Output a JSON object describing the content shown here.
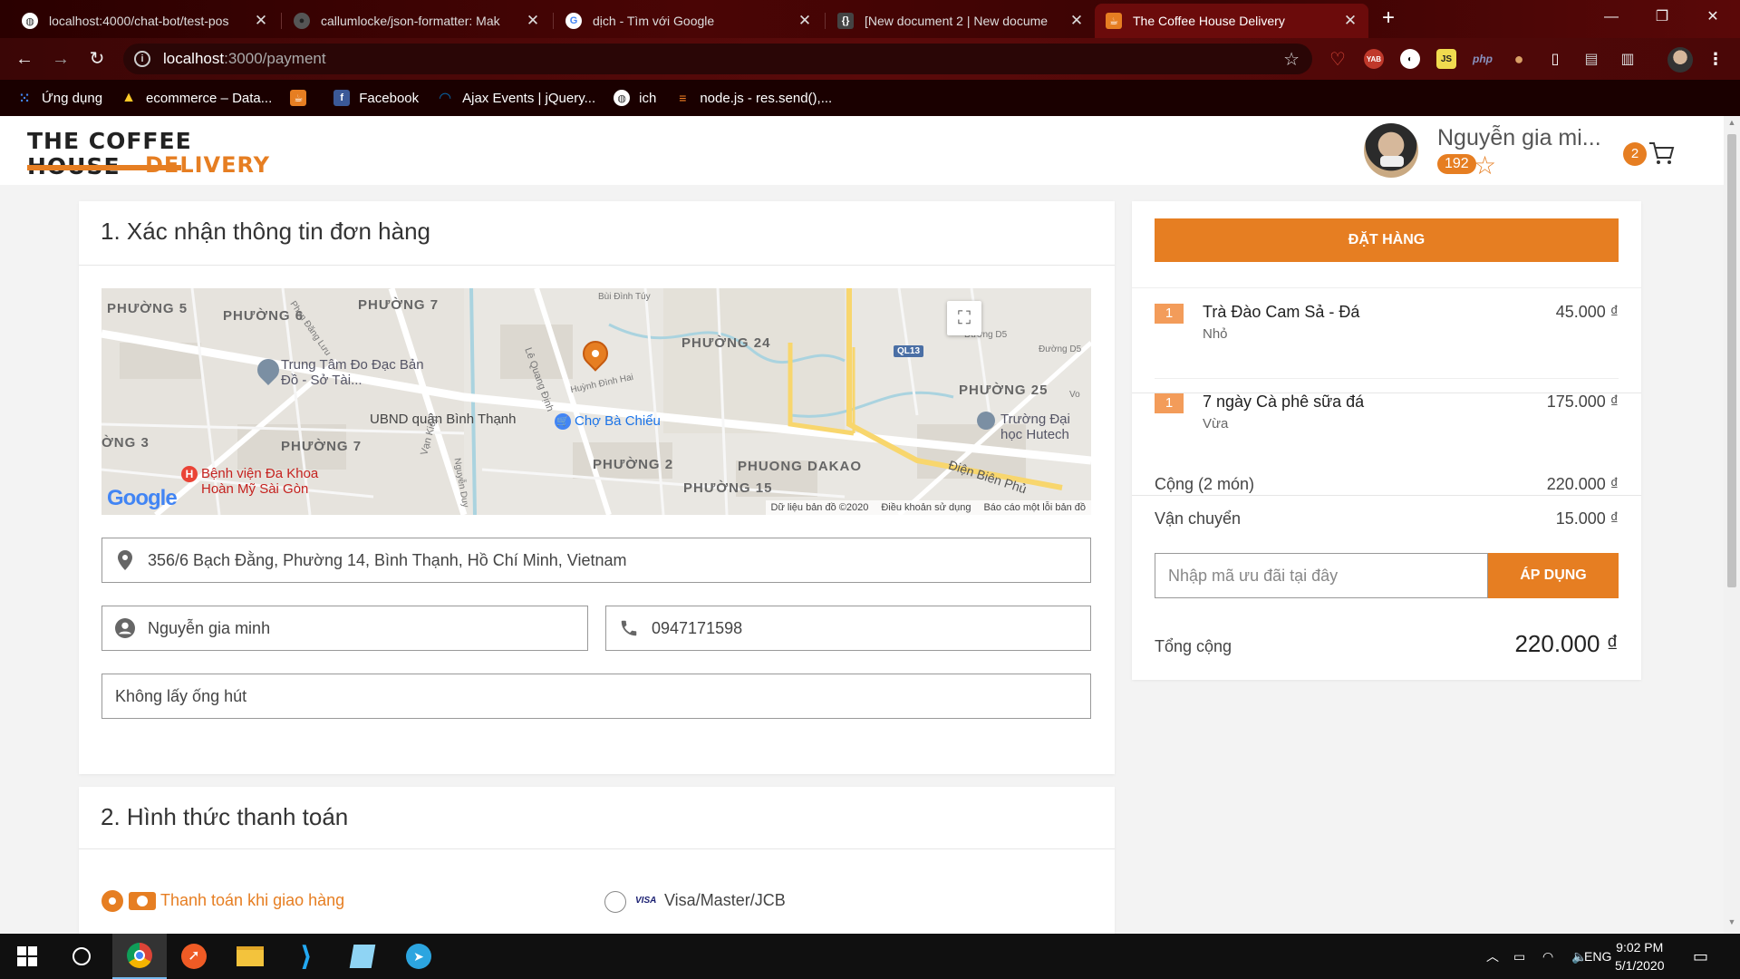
{
  "browser": {
    "tabs": [
      {
        "title": "localhost:4000/chat-bot/test-pos",
        "icon": "globe-icon"
      },
      {
        "title": "callumlocke/json-formatter: Mak",
        "icon": "github-icon"
      },
      {
        "title": "dịch - Tìm với Google",
        "icon": "google-icon"
      },
      {
        "title": "[New document 2 | New docume",
        "icon": "json-icon"
      },
      {
        "title": "The Coffee House Delivery",
        "icon": "coffee-house-icon",
        "active": true
      }
    ],
    "url_host": "localhost",
    "url_path": ":3000/payment",
    "bookmarks": [
      {
        "label": "Ứng dụng",
        "icon": "apps-grid-icon"
      },
      {
        "label": "ecommerce – Data...",
        "icon": "firebase-icon"
      },
      {
        "label": "",
        "icon": "coffee-house-icon"
      },
      {
        "label": "Facebook",
        "icon": "facebook-icon"
      },
      {
        "label": "Ajax Events | jQuery...",
        "icon": "jquery-icon"
      },
      {
        "label": "ich",
        "icon": "globe-icon"
      },
      {
        "label": "node.js - res.send(),...",
        "icon": "stackoverflow-icon"
      }
    ],
    "extension_labels": {
      "yab": "YAB",
      "js": "JS",
      "php": "php"
    }
  },
  "header": {
    "logo_line1": "THE COFFEE HOUSE",
    "logo_line2": "DELIVERY",
    "user_name": "Nguyễn gia mi...",
    "points": "192",
    "cart_count": "2"
  },
  "section1": {
    "title": "1. Xác nhận thông tin đơn hàng",
    "address": "356/6 Bạch Đằng, Phường 14, Bình Thạnh, Hồ Chí Minh, Vietnam",
    "name": "Nguyễn gia minh",
    "phone": "0947171598",
    "note": "Không lấy ống hút"
  },
  "map": {
    "labels": [
      "PHƯỜNG 5",
      "PHƯỜNG 6",
      "PHƯỜNG 7",
      "PHƯỜNG 24",
      "PHƯỜNG 25",
      "PHƯỜNG 7",
      "PHƯỜNG 2",
      "PHƯỜNG 15",
      "PHUONG DAKAO",
      "ỜNG 3"
    ],
    "pois": [
      "Trung Tâm Đo Đạc Bản Đồ - Sở Tài...",
      "UBND quận Bình Thạnh",
      "Chợ Bà Chiểu",
      "Trường Đại học Hutech",
      "Bệnh viện Đa Khoa Hoàn Mỹ Sài Gòn"
    ],
    "streets": [
      "Bùi Đình Túy",
      "Đường D5",
      "Đường D5",
      "Lê Quang Định",
      "Huỳnh Đình Hai",
      "Vạn Kiếp",
      "Nguyễn Duy",
      "Điện Biên Phủ",
      "Vo",
      "Phan Đăng Lưu"
    ],
    "road_badge": "QL13",
    "brand": "Google",
    "footer": [
      "Dữ liệu bản đồ ©2020",
      "Điều khoản sử dụng",
      "Báo cáo một lỗi bản đồ"
    ]
  },
  "section2": {
    "title": "2. Hình thức thanh toán",
    "option_cod": "Thanh toán khi giao hàng",
    "option_card": "Visa/Master/JCB",
    "visa_text": "VISA"
  },
  "order": {
    "button": "ĐẶT HÀNG",
    "items": [
      {
        "qty": "1",
        "name": "Trà Đào Cam Sả - Đá",
        "size": "Nhỏ",
        "price": "45.000 ₫"
      },
      {
        "qty": "1",
        "name": "7 ngày Cà phê sữa đá",
        "size": "Vừa",
        "price": "175.000 ₫"
      }
    ],
    "subtotal_label": "Cộng (2 món)",
    "subtotal": "220.000 ₫",
    "shipping_label": "Vận chuyển",
    "shipping": "15.000 ₫",
    "promo_placeholder": "Nhập mã ưu đãi tại đây",
    "apply": "ÁP DỤNG",
    "total_label": "Tổng cộng",
    "total": "220.000 ₫"
  },
  "taskbar": {
    "lang": "ENG",
    "time": "9:02 PM",
    "date": "5/1/2020"
  },
  "colors": {
    "accent": "#e67e22",
    "chrome": "#4a0707"
  }
}
